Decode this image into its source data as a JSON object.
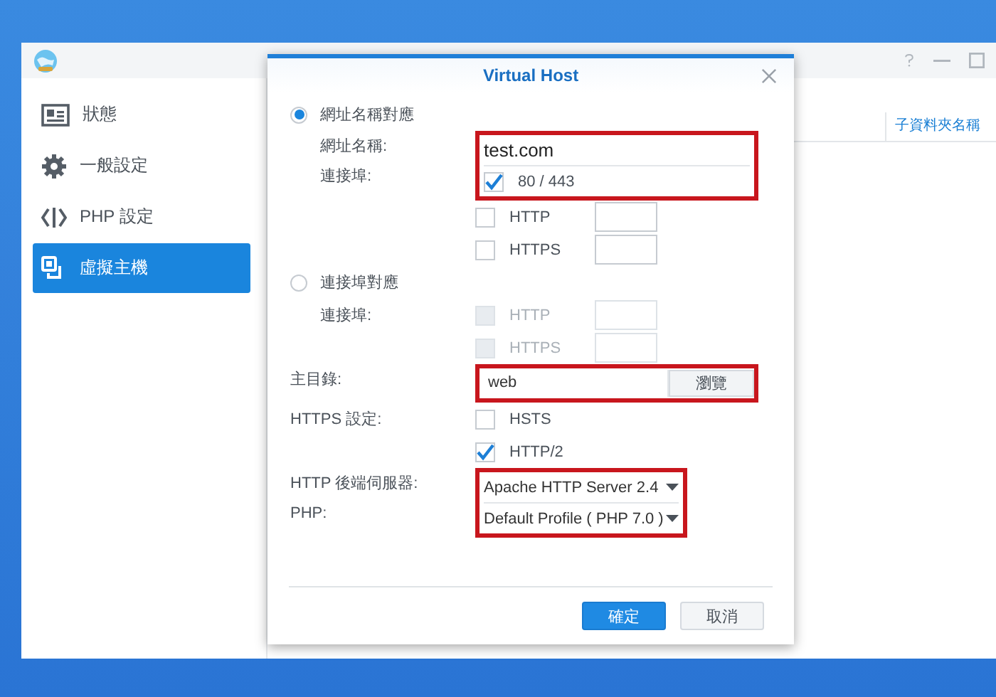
{
  "sidebar": {
    "items": [
      {
        "label": "狀態",
        "kind": "status",
        "selected": false
      },
      {
        "label": "一般設定",
        "kind": "gear",
        "selected": false
      },
      {
        "label": "PHP 設定",
        "kind": "code",
        "selected": false
      },
      {
        "label": "虛擬主機",
        "kind": "host",
        "selected": true
      }
    ]
  },
  "table": {
    "columns": [
      "子資料夾名稱"
    ]
  },
  "dialog": {
    "title": "Virtual Host",
    "rows": [
      {
        "kind": "radio",
        "label": "網址名稱對應",
        "selected": true,
        "children": [
          {
            "kind": "highlight",
            "items": [
              {
                "kind": "text",
                "label": "網址名稱:",
                "value": "test.com"
              },
              {
                "kind": "check",
                "label": "連接埠:",
                "option": "80 / 443",
                "checked": true,
                "disabled": false
              }
            ]
          },
          {
            "kind": "check_port",
            "option": "HTTP",
            "checked": false,
            "disabled": false
          },
          {
            "kind": "check_port",
            "option": "HTTPS",
            "checked": false,
            "disabled": false
          }
        ]
      },
      {
        "kind": "radio",
        "label": "連接埠對應",
        "selected": false,
        "children": [
          {
            "kind": "check_port",
            "label": "連接埠:",
            "option": "HTTP",
            "checked": false,
            "disabled": true
          },
          {
            "kind": "check_port",
            "option": "HTTPS",
            "checked": false,
            "disabled": true
          }
        ]
      },
      {
        "kind": "highlight",
        "items": [
          {
            "kind": "browse",
            "label": "主目錄:",
            "value": "web",
            "button": "瀏覽"
          }
        ]
      },
      {
        "kind": "check",
        "label": "HTTPS 設定:",
        "option": "HSTS",
        "checked": false,
        "disabled": false
      },
      {
        "kind": "check",
        "option": "HTTP/2",
        "checked": true,
        "disabled": false
      },
      {
        "kind": "highlight",
        "items": [
          {
            "kind": "select",
            "label": "HTTP 後端伺服器:",
            "value": "Apache HTTP Server 2.4"
          },
          {
            "kind": "select",
            "label": "PHP:",
            "value": "Default Profile ( PHP 7.0 )"
          }
        ]
      }
    ],
    "buttons": [
      {
        "label": "確定",
        "kind": "primary"
      },
      {
        "label": "取消",
        "kind": "secondary"
      }
    ]
  }
}
